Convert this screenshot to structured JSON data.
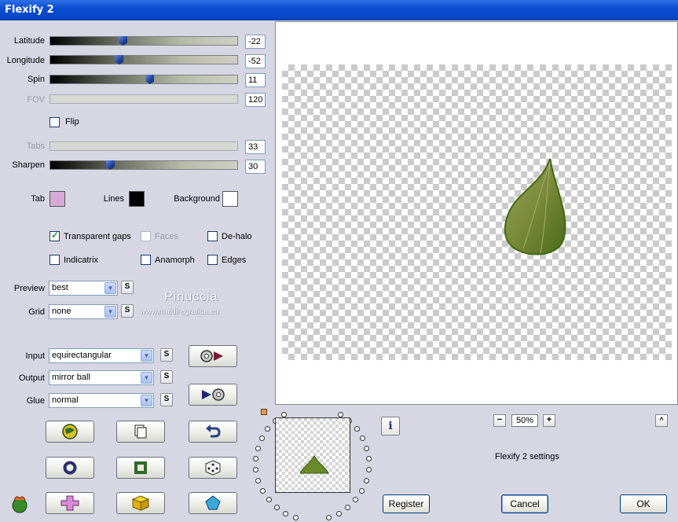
{
  "window": {
    "title": "Flexify 2"
  },
  "sliders": [
    {
      "label": "Latitude",
      "value": "-22",
      "position": 0.38,
      "enabled": true
    },
    {
      "label": "Longitude",
      "value": "-52",
      "position": 0.36,
      "enabled": true
    },
    {
      "label": "Spin",
      "value": "11",
      "position": 0.53,
      "enabled": true
    },
    {
      "label": "FOV",
      "value": "120",
      "position": null,
      "enabled": false
    },
    {
      "label": "Tabs",
      "value": "33",
      "position": null,
      "enabled": false
    },
    {
      "label": "Sharpen",
      "value": "30",
      "position": 0.31,
      "enabled": true
    }
  ],
  "flip": {
    "label": "Flip",
    "checked": false
  },
  "colors": {
    "tab": {
      "label": "Tab",
      "color": "#d8a8d8"
    },
    "lines": {
      "label": "Lines",
      "color": "#000000"
    },
    "background": {
      "label": "Background",
      "color": "#ffffff"
    }
  },
  "options": {
    "transparent_gaps": {
      "label": "Transparent gaps",
      "checked": true
    },
    "faces": {
      "label": "Faces",
      "checked": false,
      "enabled": false
    },
    "de_halo": {
      "label": "De-halo",
      "checked": false
    },
    "indicatrix": {
      "label": "Indicatrix",
      "checked": false
    },
    "anamorph": {
      "label": "Anamorph",
      "checked": false
    },
    "edges": {
      "label": "Edges",
      "checked": false
    }
  },
  "preview": {
    "label": "Preview",
    "value": "best",
    "s": "S"
  },
  "grid": {
    "label": "Grid",
    "value": "none",
    "s": "S"
  },
  "watermark": {
    "name": "Pinuccia",
    "site": "www.maidiregrafica.eu"
  },
  "input": {
    "label": "Input",
    "value": "equirectangular",
    "s": "S"
  },
  "output": {
    "label": "Output",
    "value": "mirror ball",
    "s": "S"
  },
  "glue": {
    "label": "Glue",
    "value": "normal",
    "s": "S"
  },
  "zoom": {
    "minus": "−",
    "value": "50%",
    "plus": "+"
  },
  "scroll_up": "^",
  "settings_name": "Flexify 2 settings",
  "buttons": {
    "register": "Register",
    "cancel": "Cancel",
    "ok": "OK"
  },
  "info": "i"
}
